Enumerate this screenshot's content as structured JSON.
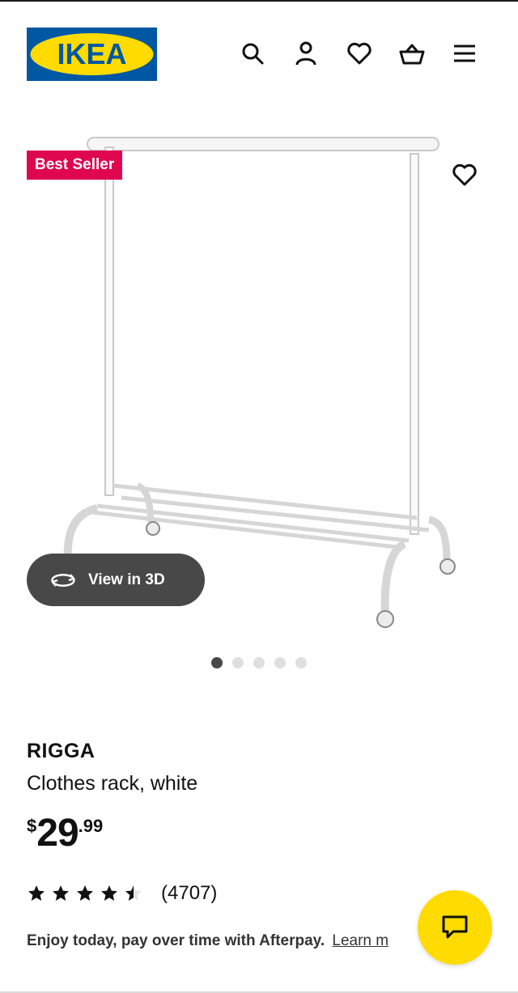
{
  "header": {
    "logo_text": "IKEA",
    "icons": [
      "search-icon",
      "account-icon",
      "heart-icon",
      "cart-icon",
      "menu-icon"
    ]
  },
  "product_image": {
    "badge": "Best Seller",
    "view_3d_label": "View in 3D",
    "carousel": {
      "total": 5,
      "active": 1
    }
  },
  "product": {
    "name": "RIGGA",
    "description": "Clothes rack, white",
    "price": {
      "currency": "$",
      "integer": "29",
      "decimal": ".99"
    },
    "rating": {
      "stars": 4.5,
      "max": 5,
      "count": "(4707)"
    }
  },
  "afterpay": {
    "text": "Enjoy today, pay over time with Afterpay.",
    "link": "Learn m"
  },
  "colors": {
    "ikea_blue": "#0058a3",
    "ikea_yellow": "#ffdb00",
    "badge_red": "#e00751",
    "dark_gray": "#484848"
  }
}
